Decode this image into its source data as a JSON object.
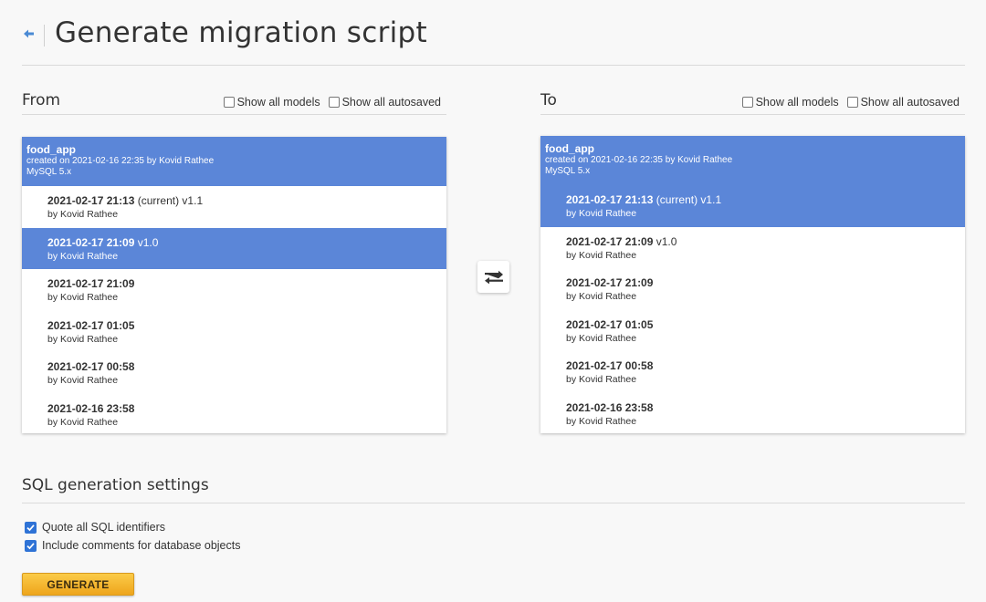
{
  "page": {
    "title": "Generate migration script"
  },
  "from": {
    "title": "From",
    "show_all_models": "Show all models",
    "show_all_autosaved": "Show all autosaved",
    "model": {
      "name": "food_app",
      "created": "created on 2021-02-16 22:35 by Kovid Rathee",
      "engine": "MySQL 5.x"
    },
    "revisions": [
      {
        "date": "2021-02-17 21:13",
        "suffix": " (current) v1.1",
        "author": "by Kovid Rathee"
      },
      {
        "date": "2021-02-17 21:09",
        "suffix": " v1.0",
        "author": "by Kovid Rathee"
      },
      {
        "date": "2021-02-17 21:09",
        "suffix": "",
        "author": "by Kovid Rathee"
      },
      {
        "date": "2021-02-17 01:05",
        "suffix": "",
        "author": "by Kovid Rathee"
      },
      {
        "date": "2021-02-17 00:58",
        "suffix": "",
        "author": "by Kovid Rathee"
      },
      {
        "date": "2021-02-16 23:58",
        "suffix": "",
        "author": "by Kovid Rathee"
      }
    ]
  },
  "to": {
    "title": "To",
    "show_all_models": "Show all models",
    "show_all_autosaved": "Show all autosaved",
    "model": {
      "name": "food_app",
      "created": "created on 2021-02-16 22:35 by Kovid Rathee",
      "engine": "MySQL 5.x"
    },
    "revisions": [
      {
        "date": "2021-02-17 21:13",
        "suffix": " (current) v1.1",
        "author": "by Kovid Rathee"
      },
      {
        "date": "2021-02-17 21:09",
        "suffix": " v1.0",
        "author": "by Kovid Rathee"
      },
      {
        "date": "2021-02-17 21:09",
        "suffix": "",
        "author": "by Kovid Rathee"
      },
      {
        "date": "2021-02-17 01:05",
        "suffix": "",
        "author": "by Kovid Rathee"
      },
      {
        "date": "2021-02-17 00:58",
        "suffix": "",
        "author": "by Kovid Rathee"
      },
      {
        "date": "2021-02-16 23:58",
        "suffix": "",
        "author": "by Kovid Rathee"
      }
    ]
  },
  "settings": {
    "title": "SQL generation settings",
    "quote_identifiers": "Quote all SQL identifiers",
    "include_comments": "Include comments for database objects"
  },
  "generate_label": "GENERATE",
  "icons": {
    "back": "arrow-left-icon",
    "swap": "swap-arrows-icon",
    "check": "check-icon"
  },
  "colors": {
    "selection": "#5b86d8",
    "accent_blue": "#2f73d6",
    "button": "#f5b733"
  }
}
